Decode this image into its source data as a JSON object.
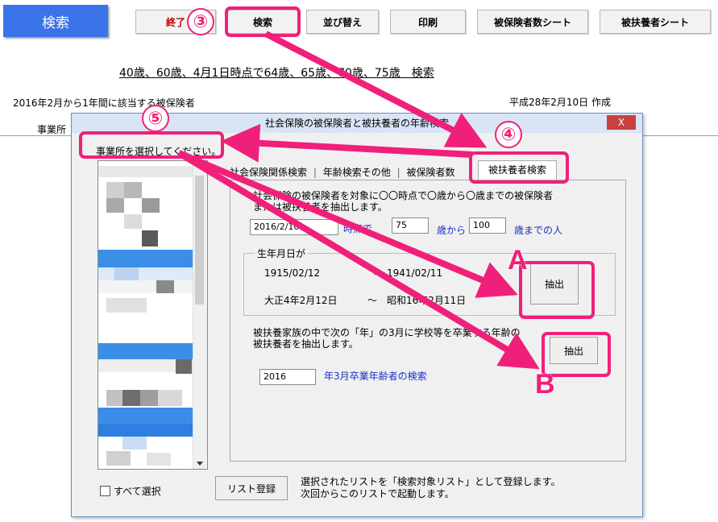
{
  "sheet": {
    "blue_button": "検索",
    "buttons": [
      "終了",
      "検索",
      "並び替え",
      "印刷",
      "被保険者数シート",
      "被扶養者シート"
    ],
    "link": "40歳、60歳、4月1日時点で64歳、65歳、70歳、75歳　検索",
    "period": "2016年2月から1年間に該当する被保険者",
    "created": "平成28年2月10日 作成",
    "office_label": "事業所"
  },
  "dialog": {
    "title": "社会保険の被保険者と被扶養者の年齢検索",
    "close_label": "X",
    "list_label": "事業所を選択してください。",
    "select_all": "すべて選択",
    "register_button": "リスト登録",
    "register_note_1": "選択されたリストを「検索対象リスト」として登録します。",
    "register_note_2": "次回からこのリストで起動します。",
    "tabs": [
      "社会保険関係検索",
      "年齢検索その他",
      "被保険者数",
      "被扶養者検索"
    ],
    "panel": {
      "desc_1": "社会保険の被保険者を対象に〇〇時点で〇歳から〇歳までの被保険者",
      "desc_2": "または被扶養者を抽出します。",
      "date_value": "2016/2/10",
      "at_label": "時点で",
      "age_from": "75",
      "from_label": "歳から",
      "age_to": "100",
      "to_label": "歳までの人",
      "group_title": "生年月日が",
      "dob_from": "1915/02/12",
      "dob_to": "1941/02/11",
      "wave": "～",
      "dob_from_wareki": "大正4年2月12日",
      "dob_to_wareki": "昭和16年2月11日",
      "extract_a": "抽出",
      "dep_desc_1": "被扶養家族の中で次の「年」の3月に学校等を卒業する年齢の",
      "dep_desc_2": "被扶養者を抽出します。",
      "year_value": "2016",
      "grad_label": "年3月卒業年齢者の検索",
      "extract_b": "抽出"
    }
  },
  "annotations": {
    "step3": "③",
    "step4": "④",
    "step5": "⑤",
    "letter_a": "A",
    "letter_b": "B",
    "color": "#f0207a"
  }
}
